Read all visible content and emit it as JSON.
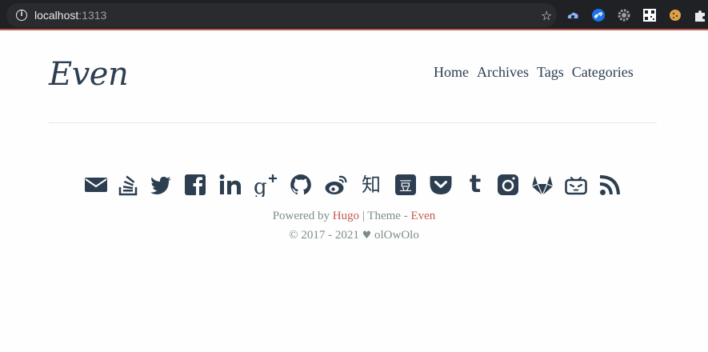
{
  "browser": {
    "url_host": "localhost",
    "url_port": ":1313"
  },
  "header": {
    "logo": "Even",
    "nav": [
      "Home",
      "Archives",
      "Tags",
      "Categories"
    ]
  },
  "footer": {
    "social_icons": [
      "email-icon",
      "stack-overflow-icon",
      "twitter-icon",
      "facebook-icon",
      "linkedin-icon",
      "google-plus-icon",
      "github-icon",
      "weibo-icon",
      "zhihu-icon",
      "douban-icon",
      "pocket-icon",
      "tumblr-icon",
      "instagram-icon",
      "gitlab-icon",
      "bilibili-icon",
      "rss-icon"
    ],
    "zhihu_glyph": "知",
    "douban_glyph": "豆",
    "tumblr_glyph": "t",
    "powered_prefix": "Powered by",
    "powered_hugo": "Hugo",
    "powered_mid": "| Theme -",
    "powered_even": "Even",
    "copyright_years": "© 2017 - 2021",
    "heart": "♥",
    "author": "olOwOlo"
  },
  "colors": {
    "text": "#2c3e50",
    "accent": "#c05b4d",
    "muted": "#7f8c8d"
  }
}
